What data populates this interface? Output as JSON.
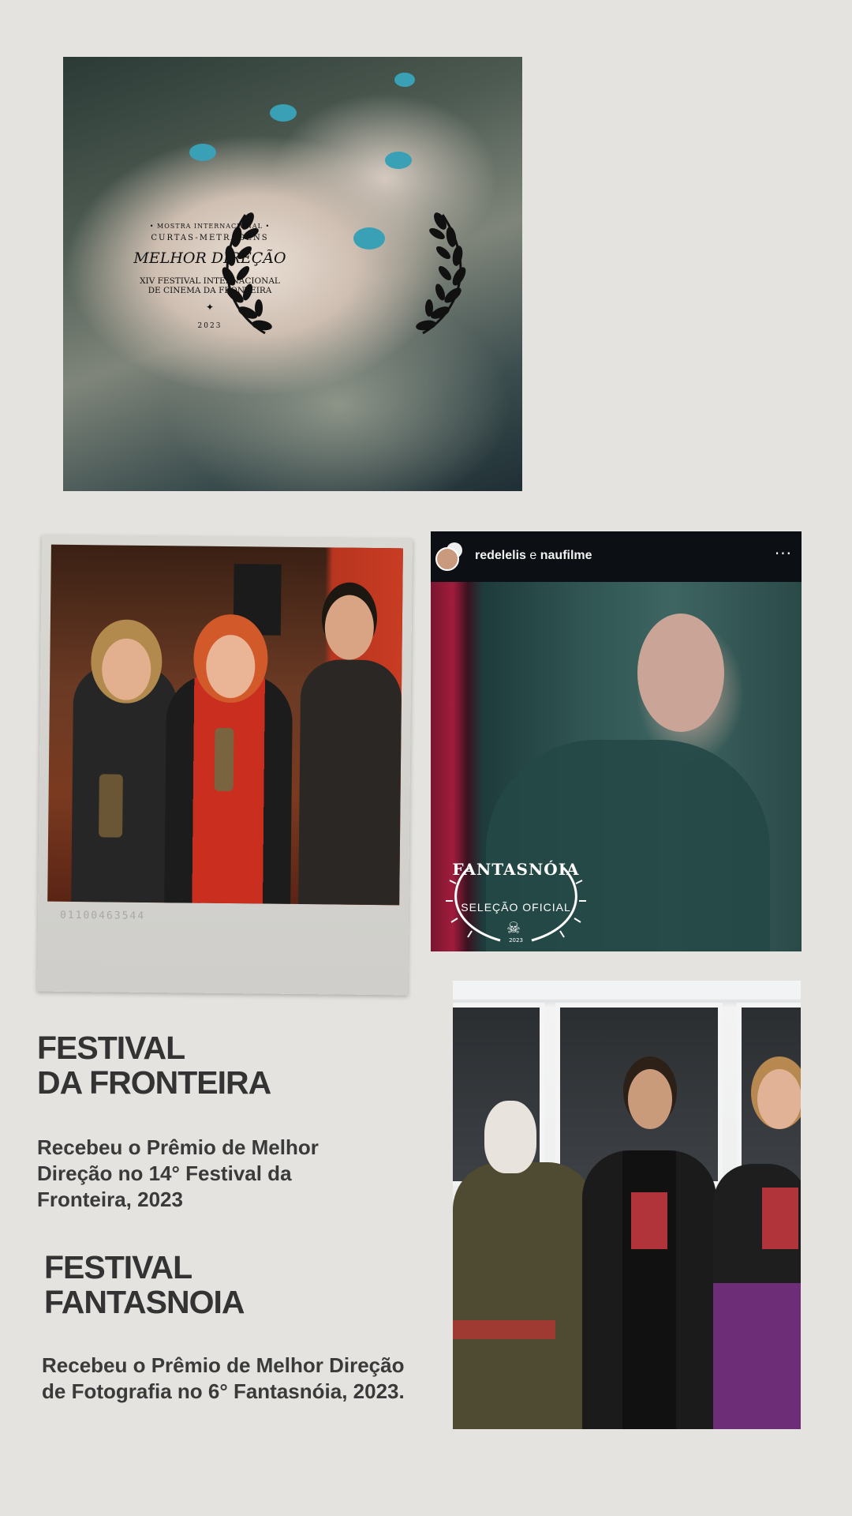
{
  "top_award": {
    "line1": "• MOSTRA INTERNACIONAL •",
    "line2": "CURTAS-METRAGENS",
    "title": "MELHOR DIREÇÃO",
    "festival_line1": "XIV FESTIVAL INTERNACIONAL",
    "festival_line2": "DE CINEMA DA FRONTEIRA",
    "star": "✦",
    "year": "2023"
  },
  "polaroid": {
    "code": "01100463544"
  },
  "instagram_post": {
    "user_a": "redelelis",
    "joiner": "e",
    "user_b": "naufilme",
    "more": "···",
    "badge_title": "FANTASNÓIA",
    "badge_label": "SELEÇÃO OFICIAL",
    "badge_year": "2023"
  },
  "sections": [
    {
      "heading_line1": "FESTIVAL",
      "heading_line2": "DA FRONTEIRA",
      "description": "Recebeu o Prêmio de Melhor Direção no 14° Festival da Fronteira, 2023"
    },
    {
      "heading_line1": "FESTIVAL",
      "heading_line2": "FANTASNOIA",
      "description": "Recebeu o Prêmio de Melhor Direção de Fotografia no 6° Fantasnóia, 2023."
    }
  ],
  "colors": {
    "background": "#e4e3df",
    "text": "#333333",
    "nail_polish": "#3aa0b5"
  }
}
